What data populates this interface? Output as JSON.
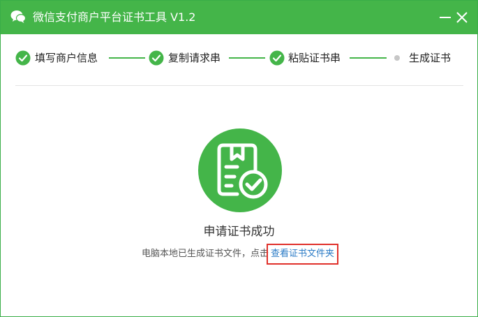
{
  "window": {
    "title": "微信支付商户平台证书工具 V1.2",
    "icons": {
      "app": "wechat-logo-icon",
      "minimize": "minimize-icon",
      "close": "close-icon"
    }
  },
  "steps": [
    {
      "label": "填写商户信息",
      "status": "done"
    },
    {
      "label": "复制请求串",
      "status": "done"
    },
    {
      "label": "粘贴证书串",
      "status": "done"
    },
    {
      "label": "生成证书",
      "status": "current"
    }
  ],
  "result": {
    "icon": "certificate-success-icon",
    "title": "申请证书成功",
    "message": "电脑本地已生成证书文件，点击",
    "link_label": "查看证书文件夹"
  },
  "colors": {
    "brand": "#44b549",
    "link": "#2b7bc6",
    "highlight": "#e0302a"
  }
}
